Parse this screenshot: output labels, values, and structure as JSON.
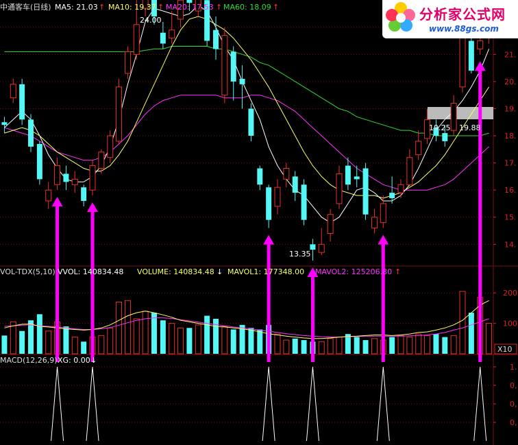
{
  "colors": {
    "background": "#000000",
    "up_candle": "#e8322d",
    "down_candle": "#54f6f6",
    "grid": "#7a1010",
    "ma5": "#ffffff",
    "ma10": "#ffff66",
    "ma20": "#ff33ff",
    "ma60": "#33dd33",
    "arrow": "#ff00ff",
    "axis_text": "#dd2020"
  },
  "header": {
    "stock_name": "中通客车(日线)",
    "ma5_label": "MA5: 21.03",
    "ma10_label": "MA10: 19.37",
    "ma20_label": "MA20: 17.53",
    "ma60_label": "MA60: 18.09",
    "up_arrow": "↑",
    "down_arrow": "↓"
  },
  "volume_header": {
    "indicator": "VOL-TDX(5,10)",
    "vvol": "VVOL: 140834.48",
    "volume": "VOLUME: 140834.48",
    "mavol1": "MAVOL1: 177348.00",
    "mavol2": "MAVOL2: 125206.80"
  },
  "macd_header": {
    "indicator": "MACD(12,26,9)",
    "xg": "XG: 0.00"
  },
  "logo": {
    "title": "分析家公式网",
    "url": "www.88gs.com"
  },
  "annotations": {
    "high_label": "24.00",
    "low_label": "13.35",
    "cursor_date": "19.25",
    "cursor_price": "19.88"
  },
  "volume_unit": "X10",
  "chart_data": {
    "type": "candlestick",
    "price_ylim": [
      13.3,
      22.5
    ],
    "price_ticks": [
      "22.",
      "21.",
      "20.",
      "19.",
      "18.",
      "17.",
      "16.",
      "15.",
      "14."
    ],
    "price_tick_values": [
      22,
      21,
      20,
      19,
      18,
      17,
      16,
      15,
      14
    ],
    "volume_ylim": [
      0,
      250
    ],
    "volume_ticks": [
      "200",
      "100"
    ],
    "volume_tick_values": [
      200,
      100
    ],
    "xg_ticks": [
      "1.",
      "0,",
      "0,",
      "0,"
    ],
    "xg_tick_values": [
      1.0,
      0.75,
      0.5,
      0.25
    ],
    "candles": [
      [
        18.5,
        18.4,
        18.7,
        18.1
      ],
      [
        19.4,
        19.9,
        20.1,
        19.2
      ],
      [
        19.9,
        18.6,
        20.1,
        18.4
      ],
      [
        18.6,
        17.6,
        18.8,
        17.4
      ],
      [
        17.7,
        16.4,
        17.8,
        16.2
      ],
      [
        15.6,
        16.0,
        16.3,
        15.3
      ],
      [
        16.2,
        16.9,
        17.2,
        16.0
      ],
      [
        16.6,
        16.3,
        16.9,
        16.0
      ],
      [
        16.2,
        16.4,
        16.7,
        15.9
      ],
      [
        16.1,
        15.6,
        16.2,
        15.4
      ],
      [
        16.0,
        16.9,
        17.1,
        15.8
      ],
      [
        16.8,
        17.4,
        17.5,
        16.6
      ],
      [
        17.2,
        18.0,
        18.2,
        17.0
      ],
      [
        17.8,
        19.8,
        20.1,
        17.7
      ],
      [
        20.3,
        21.1,
        21.3,
        20.1
      ],
      [
        21.0,
        22.1,
        23.1,
        20.8
      ],
      [
        22.7,
        23.5,
        24.0,
        22.4
      ],
      [
        23.3,
        22.4,
        23.6,
        22.1
      ],
      [
        21.8,
        21.4,
        22.2,
        21.2
      ],
      [
        21.6,
        21.9,
        22.6,
        21.4
      ],
      [
        22.3,
        23.0,
        23.4,
        22.0
      ],
      [
        23.1,
        22.9,
        23.7,
        22.6
      ],
      [
        22.6,
        23.2,
        23.4,
        22.4
      ],
      [
        23.0,
        21.5,
        23.2,
        21.3
      ],
      [
        21.9,
        21.2,
        22.4,
        20.8
      ],
      [
        19.5,
        21.7,
        22.0,
        19.2
      ],
      [
        21.1,
        20.0,
        21.3,
        19.3
      ],
      [
        20.1,
        19.9,
        20.6,
        19.0
      ],
      [
        19.0,
        18.0,
        19.2,
        17.8
      ],
      [
        16.8,
        16.2,
        16.9,
        16.0
      ],
      [
        16.1,
        14.9,
        16.2,
        14.6
      ],
      [
        15.4,
        16.1,
        16.4,
        15.1
      ],
      [
        16.4,
        16.8,
        17.0,
        16.1
      ],
      [
        16.5,
        15.9,
        16.7,
        15.6
      ],
      [
        16.2,
        14.9,
        16.4,
        14.7
      ],
      [
        14.0,
        13.8,
        14.2,
        13.4
      ],
      [
        13.7,
        14.0,
        14.6,
        13.6
      ],
      [
        14.4,
        15.1,
        15.3,
        14.1
      ],
      [
        15.5,
        16.6,
        16.9,
        15.3
      ],
      [
        16.9,
        16.2,
        17.2,
        16.0
      ],
      [
        16.5,
        16.4,
        16.9,
        16.1
      ],
      [
        16.8,
        15.1,
        17.0,
        14.9
      ],
      [
        14.6,
        15.0,
        15.3,
        14.4
      ],
      [
        14.8,
        15.5,
        15.8,
        14.6
      ],
      [
        15.9,
        15.7,
        16.5,
        15.5
      ],
      [
        15.9,
        16.2,
        16.4,
        15.7
      ],
      [
        16.2,
        17.2,
        17.5,
        16.1
      ],
      [
        17.3,
        17.8,
        18.2,
        17.1
      ],
      [
        17.9,
        18.6,
        19.0,
        17.7
      ],
      [
        18.3,
        18.0,
        18.6,
        17.8
      ],
      [
        18.1,
        17.8,
        18.4,
        17.6
      ],
      [
        18.2,
        19.2,
        19.5,
        18.0
      ],
      [
        19.8,
        21.6,
        22.6,
        19.6
      ],
      [
        21.5,
        20.4,
        22.3,
        20.3
      ],
      [
        21.2,
        21.5,
        22.9,
        21.0
      ],
      [
        21.6,
        22.6,
        22.8,
        21.4
      ]
    ],
    "volume": [
      60,
      105,
      75,
      110,
      130,
      75,
      105,
      90,
      55,
      40,
      55,
      60,
      85,
      170,
      175,
      115,
      140,
      135,
      110,
      100,
      85,
      85,
      95,
      125,
      115,
      90,
      80,
      95,
      85,
      80,
      95,
      65,
      45,
      50,
      45,
      40,
      40,
      50,
      55,
      65,
      55,
      45,
      50,
      45,
      55,
      60,
      55,
      65,
      60,
      65,
      55,
      60,
      205,
      135,
      185,
      100
    ],
    "mavol1": [
      85,
      92,
      97,
      98,
      90,
      88,
      85,
      82,
      80,
      78,
      80,
      85,
      95,
      110,
      125,
      135,
      140,
      135,
      128,
      120,
      110,
      105,
      100,
      95,
      90,
      88,
      85,
      82,
      78,
      72,
      66,
      62,
      58,
      55,
      52,
      50,
      50,
      52,
      55,
      57,
      58,
      60,
      62,
      62,
      60,
      62,
      65,
      70,
      72,
      78,
      85,
      95,
      110,
      135,
      160,
      175
    ],
    "mavol2": [
      90,
      92,
      94,
      95,
      92,
      90,
      88,
      85,
      82,
      80,
      80,
      82,
      86,
      94,
      102,
      110,
      115,
      118,
      118,
      116,
      112,
      108,
      104,
      100,
      96,
      92,
      88,
      85,
      82,
      78,
      74,
      70,
      66,
      63,
      60,
      58,
      56,
      55,
      55,
      56,
      57,
      58,
      58,
      58,
      58,
      58,
      59,
      60,
      62,
      65,
      70,
      78,
      85,
      95,
      105,
      115
    ],
    "ma5": [
      18.3,
      18.6,
      18.9,
      18.6,
      18.0,
      17.3,
      16.8,
      16.4,
      16.3,
      16.3,
      16.5,
      16.9,
      17.6,
      18.6,
      19.9,
      21.0,
      22.2,
      22.7,
      22.6,
      22.5,
      22.4,
      22.5,
      22.8,
      22.6,
      22.0,
      21.3,
      20.8,
      20.0,
      19.3,
      18.6,
      17.6,
      16.9,
      16.4,
      16.0,
      15.8,
      15.4,
      15.0,
      14.8,
      15.0,
      15.5,
      16.0,
      16.1,
      15.9,
      15.6,
      15.6,
      15.8,
      16.2,
      16.8,
      17.5,
      18.2,
      18.6,
      18.9,
      19.3,
      19.8,
      20.4,
      21.2
    ],
    "ma10": [
      18.1,
      18.2,
      18.3,
      18.2,
      18.0,
      17.7,
      17.4,
      17.2,
      17.0,
      16.8,
      16.7,
      16.7,
      16.9,
      17.3,
      17.8,
      18.5,
      19.2,
      19.9,
      20.6,
      21.3,
      21.9,
      22.3,
      22.4,
      22.3,
      22.1,
      21.9,
      21.6,
      21.2,
      20.8,
      20.3,
      19.8,
      19.2,
      18.6,
      18.0,
      17.4,
      16.9,
      16.5,
      16.2,
      16.0,
      15.9,
      15.8,
      15.8,
      15.8,
      15.7,
      15.8,
      15.9,
      16.1,
      16.3,
      16.6,
      16.9,
      17.3,
      17.8,
      18.3,
      18.8,
      19.3,
      19.8
    ],
    "ma20": [
      18.3,
      18.2,
      18.1,
      18.0,
      17.8,
      17.6,
      17.4,
      17.3,
      17.2,
      17.1,
      17.1,
      17.2,
      17.4,
      17.7,
      18.0,
      18.4,
      18.8,
      19.1,
      19.3,
      19.4,
      19.5,
      19.5,
      19.5,
      19.5,
      19.5,
      19.4,
      19.4,
      19.4,
      19.5,
      19.5,
      19.4,
      19.3,
      19.1,
      18.9,
      18.6,
      18.3,
      18.0,
      17.7,
      17.4,
      17.1,
      16.8,
      16.6,
      16.4,
      16.2,
      16.1,
      16.0,
      16.0,
      16.0,
      16.0,
      16.1,
      16.2,
      16.4,
      16.7,
      17.0,
      17.3,
      17.6
    ],
    "ma60": [
      21.1,
      21.1,
      21.1,
      21.1,
      21.1,
      21.1,
      21.1,
      21.1,
      21.1,
      21.1,
      21.1,
      21.1,
      21.1,
      21.1,
      21.1,
      21.1,
      21.15,
      21.2,
      21.2,
      21.3,
      21.3,
      21.3,
      21.3,
      21.3,
      21.2,
      21.2,
      21.1,
      21.0,
      20.9,
      20.7,
      20.6,
      20.4,
      20.2,
      20.0,
      19.8,
      19.6,
      19.4,
      19.2,
      19.0,
      18.9,
      18.7,
      18.6,
      18.5,
      18.4,
      18.3,
      18.2,
      18.2,
      18.1,
      18.1,
      18.0,
      18.0,
      18.0,
      18.0,
      18.0,
      18.0,
      18.1
    ],
    "signal_indices": [
      6,
      10,
      30,
      35,
      43,
      54
    ]
  }
}
